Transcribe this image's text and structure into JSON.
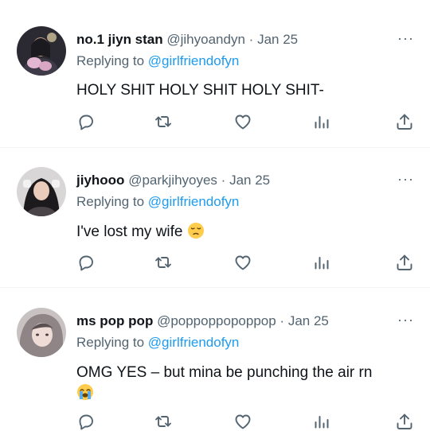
{
  "tweets": [
    {
      "display_name": "no.1 jiyn stan",
      "handle": "@jihyoandyn",
      "sep": "·",
      "date": "Jan 25",
      "replying_prefix": "Replying to",
      "replying_to": "@girlfriendofyn",
      "text": "HOLY SHIT HOLY SHIT HOLY SHIT-",
      "emoji": ""
    },
    {
      "display_name": "jiyhooo",
      "handle": "@parkjihyoyes",
      "sep": "·",
      "date": "Jan 25",
      "replying_prefix": "Replying to",
      "replying_to": "@girlfriendofyn",
      "text": "I've lost my wife",
      "emoji": "pensive-face"
    },
    {
      "display_name": "ms pop pop",
      "handle": "@poppoppopoppop",
      "sep": "·",
      "date": "Jan 25",
      "replying_prefix": "Replying to",
      "replying_to": "@girlfriendofyn",
      "text": "OMG YES – but mina be punching the air rn",
      "emoji": "loudly-crying-face"
    }
  ],
  "more_label": "···",
  "action_icons": [
    "reply-icon",
    "retweet-icon",
    "like-icon",
    "views-icon",
    "share-icon"
  ],
  "colors": {
    "mention": "#1d9bf0",
    "meta": "#536471",
    "text": "#0f1419",
    "divider": "#eff3f4"
  }
}
